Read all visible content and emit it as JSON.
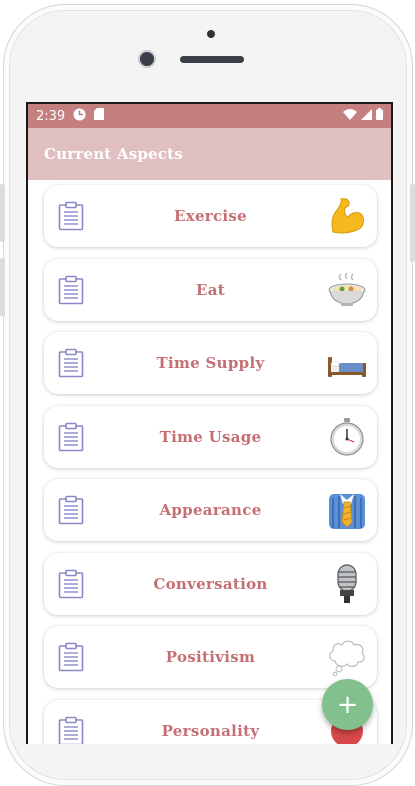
{
  "status": {
    "time": "2:39"
  },
  "appbar": {
    "title": "Current Aspects"
  },
  "aspects": [
    {
      "label": "Exercise",
      "icon": "flexed-biceps-icon"
    },
    {
      "label": "Eat",
      "icon": "food-bowl-icon"
    },
    {
      "label": "Time Supply",
      "icon": "bed-icon"
    },
    {
      "label": "Time Usage",
      "icon": "stopwatch-icon"
    },
    {
      "label": "Appearance",
      "icon": "shirt-tie-icon"
    },
    {
      "label": "Conversation",
      "icon": "microphone-icon"
    },
    {
      "label": "Positivism",
      "icon": "thought-balloon-icon"
    },
    {
      "label": "Personality",
      "icon": "personality-icon"
    }
  ],
  "colors": {
    "statusbar": "#c4807f",
    "appbar": "#e0bfc1",
    "label": "#c46f74",
    "fab": "#82c08e",
    "clipboard": "#8c88c8"
  },
  "fab": {
    "symbol": "+"
  }
}
